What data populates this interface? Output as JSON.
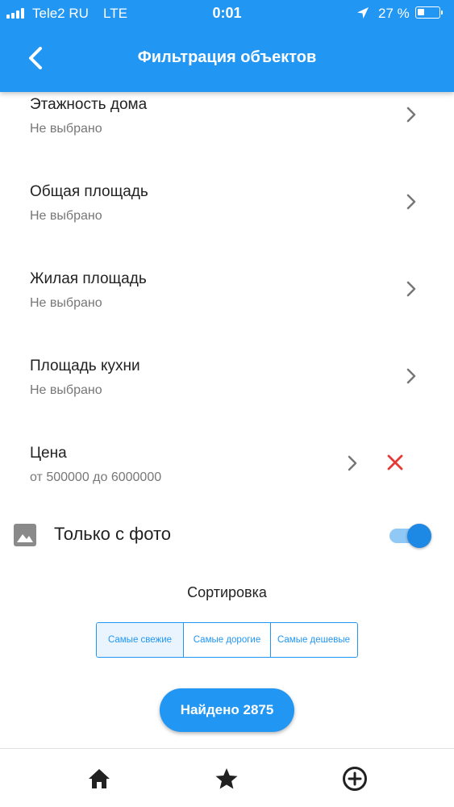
{
  "status_bar": {
    "carrier": "Tele2 RU",
    "network": "LTE",
    "time": "0:01",
    "battery": "27 %"
  },
  "header": {
    "title": "Фильтрация объектов",
    "back_icon": "chevron-left-icon"
  },
  "filters": [
    {
      "label": "Этажность дома",
      "value": "Не выбрано"
    },
    {
      "label": "Общая площадь",
      "value": "Не выбрано"
    },
    {
      "label": "Жилая площадь",
      "value": "Не выбрано"
    },
    {
      "label": "Площадь кухни",
      "value": "Не выбрано"
    },
    {
      "label": "Цена",
      "value": "от 500000 до 6000000"
    }
  ],
  "photo_filter": {
    "label": "Только с фото",
    "icon": "image-icon",
    "enabled": true
  },
  "sort": {
    "title": "Сортировка",
    "options": [
      "Самые свежие",
      "Самые дорогие",
      "Самые дешевые"
    ],
    "selected": "Самые свежие"
  },
  "results_button": "Найдено 2875",
  "bottom_nav": [
    "home-icon",
    "star-icon",
    "add-circle-icon"
  ],
  "colors": {
    "primary": "#2196F3",
    "clear": "#E53935",
    "text": "#222222",
    "secondary_text": "#777777"
  }
}
